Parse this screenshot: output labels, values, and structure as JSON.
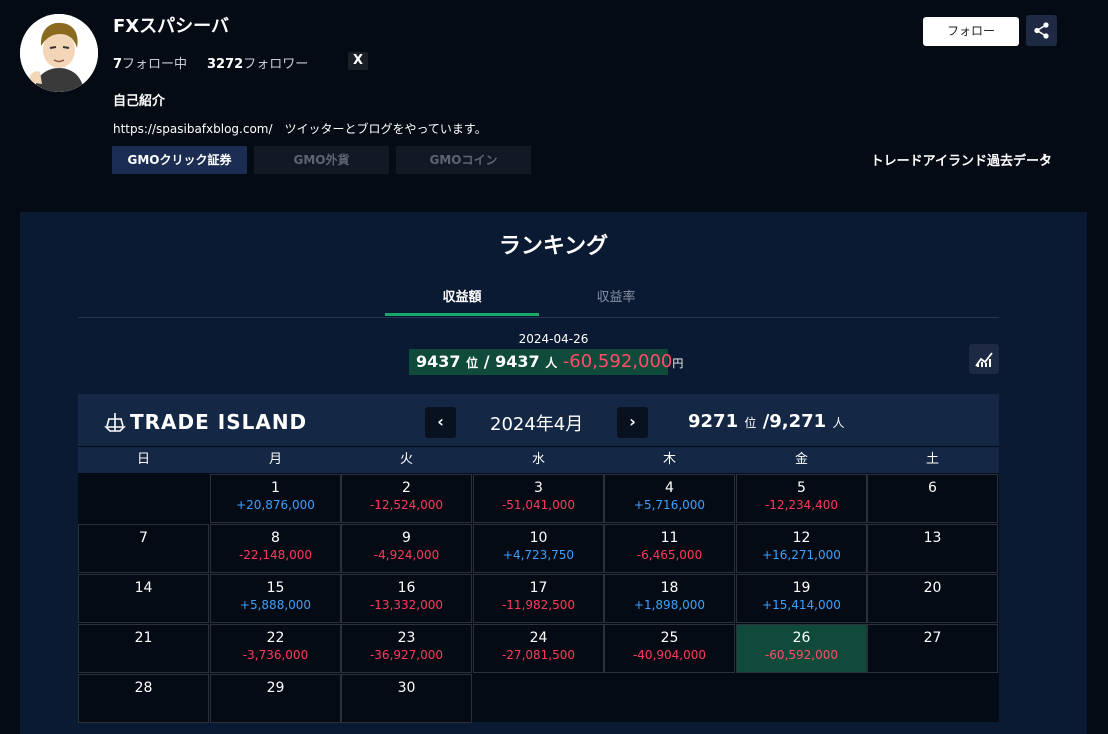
{
  "profile": {
    "username": "FXスパシーバ",
    "following_count": "7",
    "following_label": "フォロー中",
    "followers_count": "3272",
    "followers_label": "フォロワー",
    "x_icon": "X",
    "bio_title": "自己紹介",
    "bio_text": "https://spasibafxblog.com/　ツイッターとブログをやっています。",
    "follow_label": "フォロー",
    "past_data_link": "トレードアイランド過去データ",
    "broker_tabs": [
      "GMOクリック証券",
      "GMO外貨",
      "GMOコイン"
    ]
  },
  "ranking": {
    "title": "ランキング",
    "tabs": [
      "収益額",
      "収益率"
    ],
    "date": "2024-04-26",
    "rank": "9437",
    "rank_unit": "位",
    "total": "9437",
    "total_unit": "人",
    "profit": "-60,592,000",
    "profit_unit": "円"
  },
  "calendar": {
    "logo": "TRADE ISLAND",
    "month": "2024年4月",
    "month_rank": "9271",
    "month_rank_unit": "位",
    "month_total": "/9,271",
    "month_total_unit": "人",
    "weekdays": [
      "日",
      "月",
      "火",
      "水",
      "木",
      "金",
      "土"
    ],
    "days": [
      {
        "day": "1",
        "pl": "+20,876,000"
      },
      {
        "day": "2",
        "pl": "-12,524,000"
      },
      {
        "day": "3",
        "pl": "-51,041,000"
      },
      {
        "day": "4",
        "pl": "+5,716,000"
      },
      {
        "day": "5",
        "pl": "-12,234,400"
      },
      {
        "day": "6",
        "pl": ""
      },
      {
        "day": "7",
        "pl": ""
      },
      {
        "day": "8",
        "pl": "-22,148,000"
      },
      {
        "day": "9",
        "pl": "-4,924,000"
      },
      {
        "day": "10",
        "pl": "+4,723,750"
      },
      {
        "day": "11",
        "pl": "-6,465,000"
      },
      {
        "day": "12",
        "pl": "+16,271,000"
      },
      {
        "day": "13",
        "pl": ""
      },
      {
        "day": "14",
        "pl": ""
      },
      {
        "day": "15",
        "pl": "+5,888,000"
      },
      {
        "day": "16",
        "pl": "-13,332,000"
      },
      {
        "day": "17",
        "pl": "-11,982,500"
      },
      {
        "day": "18",
        "pl": "+1,898,000"
      },
      {
        "day": "19",
        "pl": "+15,414,000"
      },
      {
        "day": "20",
        "pl": ""
      },
      {
        "day": "21",
        "pl": ""
      },
      {
        "day": "22",
        "pl": "-3,736,000"
      },
      {
        "day": "23",
        "pl": "-36,927,000"
      },
      {
        "day": "24",
        "pl": "-27,081,500"
      },
      {
        "day": "25",
        "pl": "-40,904,000"
      },
      {
        "day": "26",
        "pl": "-60,592,000",
        "selected": true
      },
      {
        "day": "27",
        "pl": ""
      },
      {
        "day": "28",
        "pl": ""
      },
      {
        "day": "29",
        "pl": ""
      },
      {
        "day": "30",
        "pl": ""
      }
    ],
    "first_weekday_index": 1,
    "colors": {
      "positive": "#3aa0ff",
      "negative": "#ff3a5c",
      "selected": "#0f4a3a"
    }
  }
}
